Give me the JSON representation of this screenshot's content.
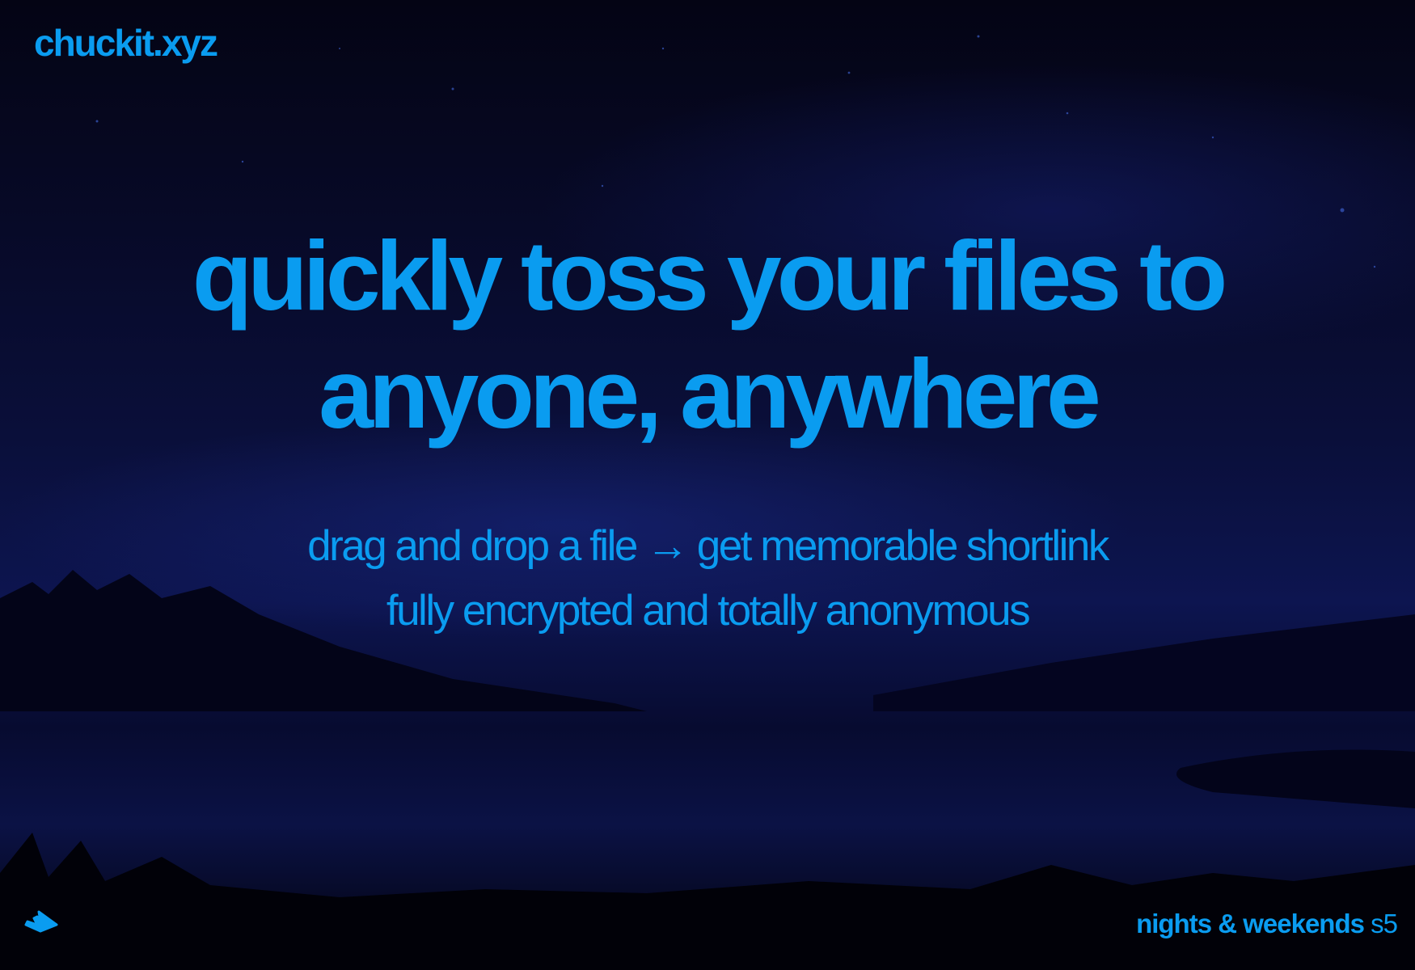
{
  "logo": "chuckit.xyz",
  "headline": {
    "line1": "quickly toss your files to",
    "line2": "anyone, anywhere"
  },
  "subtitle": {
    "line1": "drag and drop a file → get memorable shortlink",
    "line2": "fully encrypted and totally anonymous"
  },
  "footer": {
    "label": "nights & weekends",
    "season": "s5"
  },
  "colors": {
    "accent": "#0a9cf0",
    "background": "#02020f"
  }
}
